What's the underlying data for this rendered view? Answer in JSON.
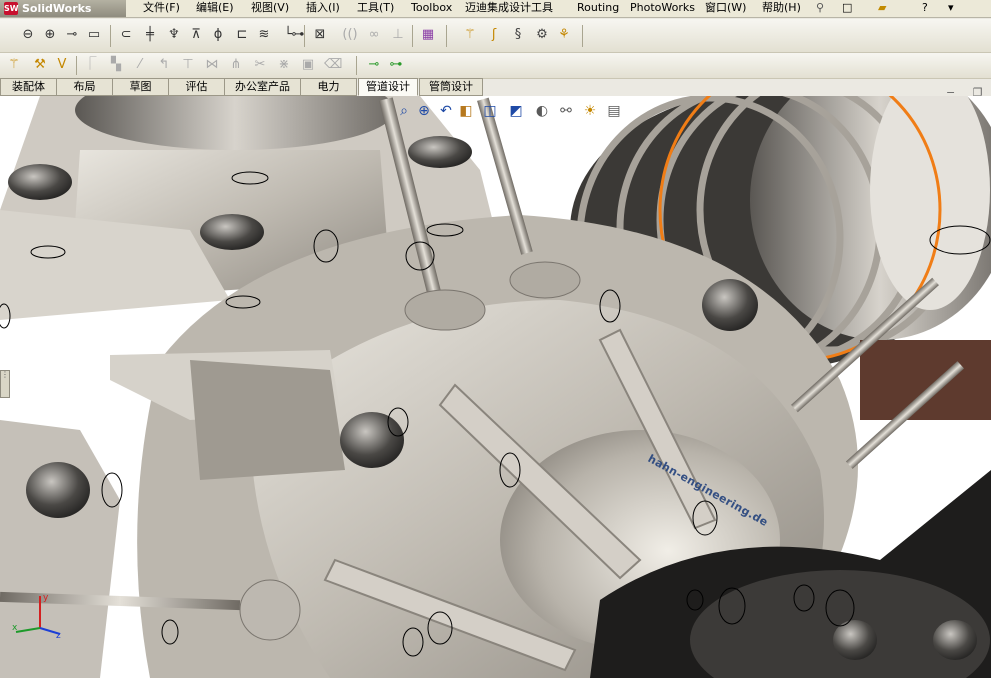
{
  "app": {
    "logo_text": "SolidWorks",
    "menu": [
      {
        "label": "文件(F)"
      },
      {
        "label": "编辑(E)"
      },
      {
        "label": "视图(V)"
      },
      {
        "label": "插入(I)"
      },
      {
        "label": "工具(T)"
      },
      {
        "label": "Toolbox"
      },
      {
        "label": "迈迪集成设计工具"
      },
      {
        "label": "Routing"
      },
      {
        "label": "PhotoWorks"
      },
      {
        "label": "窗口(W)"
      },
      {
        "label": "帮助(H)"
      }
    ]
  },
  "command_tabs": [
    {
      "label": "装配体"
    },
    {
      "label": "布局"
    },
    {
      "label": "草图"
    },
    {
      "label": "评估"
    },
    {
      "label": "办公室产品"
    },
    {
      "label": "电力"
    },
    {
      "label": "管道设计"
    },
    {
      "label": "管筒设计"
    }
  ],
  "active_tab": "管道设计",
  "model": {
    "watermark_text": "hahn-engineering.de"
  },
  "triad_labels": {
    "x": "x",
    "y": "y",
    "z": "z"
  },
  "colors": {
    "accent_orange": "#f07d16",
    "metal_light": "#d8d4cc",
    "metal_dark": "#6f6b66",
    "background": "#ffffff"
  }
}
